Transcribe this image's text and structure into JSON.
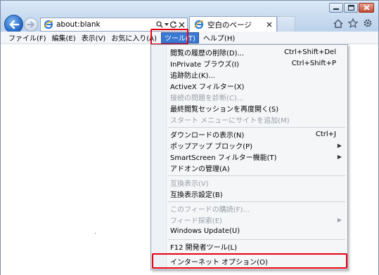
{
  "address_bar": {
    "url": "about:blank"
  },
  "tab": {
    "label": "空白のページ"
  },
  "menubar": {
    "items": [
      "ファイル(F)",
      "編集(E)",
      "表示(V)",
      "お気に入り(A)",
      "ツール(T)",
      "ヘルプ(H)"
    ]
  },
  "tools_menu": {
    "items": [
      {
        "label": "閲覧の履歴の削除(D)...",
        "shortcut": "Ctrl+Shift+Del",
        "disabled": false
      },
      {
        "label": "InPrivate ブラウズ(I)",
        "shortcut": "Ctrl+Shift+P",
        "disabled": false
      },
      {
        "label": "追跡防止(K)...",
        "shortcut": "",
        "disabled": false
      },
      {
        "label": "ActiveX フィルター(X)",
        "shortcut": "",
        "disabled": false
      },
      {
        "label": "接続の問題を診断(C)...",
        "shortcut": "",
        "disabled": true
      },
      {
        "label": "最終閲覧セッションを再度開く(S)",
        "shortcut": "",
        "disabled": false
      },
      {
        "label": "スタート メニューにサイトを追加(M)",
        "shortcut": "",
        "disabled": true
      },
      {
        "label": "ダウンロードの表示(N)",
        "shortcut": "Ctrl+J",
        "disabled": false
      },
      {
        "label": "ポップアップ ブロック(P)",
        "shortcut": "",
        "disabled": false,
        "submenu": true
      },
      {
        "label": "SmartScreen フィルター機能(T)",
        "shortcut": "",
        "disabled": false,
        "submenu": true
      },
      {
        "label": "アドオンの管理(A)",
        "shortcut": "",
        "disabled": false
      },
      {
        "label": "互換表示(V)",
        "shortcut": "",
        "disabled": true
      },
      {
        "label": "互換表示設定(B)",
        "shortcut": "",
        "disabled": false
      },
      {
        "label": "このフィードの購読(F)...",
        "shortcut": "",
        "disabled": true
      },
      {
        "label": "フィード探索(E)",
        "shortcut": "",
        "disabled": true,
        "submenu": true
      },
      {
        "label": "Windows Update(U)",
        "shortcut": "",
        "disabled": false
      },
      {
        "label": "F12 開発者ツール(L)",
        "shortcut": "",
        "disabled": false
      },
      {
        "label": "インターネット オプション(O)",
        "shortcut": "",
        "disabled": false
      }
    ]
  },
  "colors": {
    "highlight_box": "#e60012",
    "menu_selected": "#3a78d4"
  },
  "icons": {
    "back": "arrow-left-icon",
    "forward": "arrow-right-icon",
    "ie": "ie-logo-icon",
    "search": "search-icon",
    "refresh": "refresh-icon",
    "stop": "close-icon",
    "home": "home-icon",
    "favorites": "star-icon",
    "tools": "gear-icon"
  }
}
